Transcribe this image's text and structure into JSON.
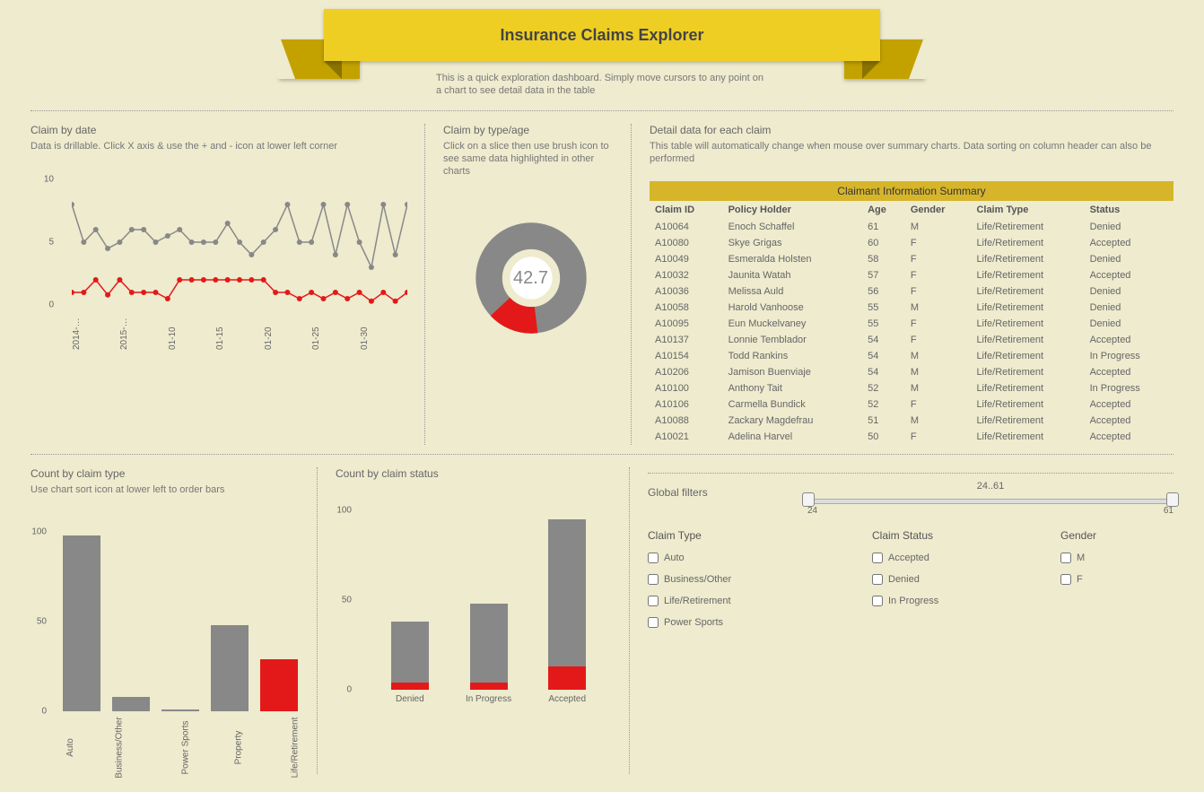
{
  "header": {
    "title": "Insurance Claims Explorer",
    "subtitle": "This is a quick exploration dashboard. Simply move cursors to any point on a chart to see detail data in the table"
  },
  "claim_by_date": {
    "title": "Claim by date",
    "hint": "Data is drillable. Click X axis & use the + and - icon at lower left corner"
  },
  "claim_by_type_age": {
    "title": "Claim by type/age",
    "hint": "Click on a slice then use brush icon to see same data highlighted in other charts",
    "center_value": "42.7"
  },
  "detail": {
    "title": "Detail data for each claim",
    "hint": "This table will automatically change when mouse over summary charts. Data sorting on column header can also be performed",
    "table_title": "Claimant Information Summary",
    "columns": [
      "Claim ID",
      "Policy Holder",
      "Age",
      "Gender",
      "Claim Type",
      "Status"
    ],
    "rows": [
      {
        "id": "A10064",
        "name": "Enoch Schaffel",
        "age": "61",
        "gender": "M",
        "type": "Life/Retirement",
        "status": "Denied"
      },
      {
        "id": "A10080",
        "name": "Skye Grigas",
        "age": "60",
        "gender": "F",
        "type": "Life/Retirement",
        "status": "Accepted"
      },
      {
        "id": "A10049",
        "name": "Esmeralda Holsten",
        "age": "58",
        "gender": "F",
        "type": "Life/Retirement",
        "status": "Denied"
      },
      {
        "id": "A10032",
        "name": "Jaunita Watah",
        "age": "57",
        "gender": "F",
        "type": "Life/Retirement",
        "status": "Accepted"
      },
      {
        "id": "A10036",
        "name": "Melissa Auld",
        "age": "56",
        "gender": "F",
        "type": "Life/Retirement",
        "status": "Denied"
      },
      {
        "id": "A10058",
        "name": "Harold Vanhoose",
        "age": "55",
        "gender": "M",
        "type": "Life/Retirement",
        "status": "Denied"
      },
      {
        "id": "A10095",
        "name": "Eun Muckelvaney",
        "age": "55",
        "gender": "F",
        "type": "Life/Retirement",
        "status": "Denied"
      },
      {
        "id": "A10137",
        "name": "Lonnie Temblador",
        "age": "54",
        "gender": "F",
        "type": "Life/Retirement",
        "status": "Accepted"
      },
      {
        "id": "A10154",
        "name": "Todd Rankins",
        "age": "54",
        "gender": "M",
        "type": "Life/Retirement",
        "status": "In Progress"
      },
      {
        "id": "A10206",
        "name": "Jamison Buenviaje",
        "age": "54",
        "gender": "M",
        "type": "Life/Retirement",
        "status": "Accepted"
      },
      {
        "id": "A10100",
        "name": "Anthony Tait",
        "age": "52",
        "gender": "M",
        "type": "Life/Retirement",
        "status": "In Progress"
      },
      {
        "id": "A10106",
        "name": "Carmella Bundick",
        "age": "52",
        "gender": "F",
        "type": "Life/Retirement",
        "status": "Accepted"
      },
      {
        "id": "A10088",
        "name": "Zackary Magdefrau",
        "age": "51",
        "gender": "M",
        "type": "Life/Retirement",
        "status": "Accepted"
      },
      {
        "id": "A10021",
        "name": "Adelina Harvel",
        "age": "50",
        "gender": "F",
        "type": "Life/Retirement",
        "status": "Accepted"
      }
    ]
  },
  "count_by_type": {
    "title": "Count by claim type",
    "hint": "Use chart sort icon at lower left to order bars"
  },
  "count_by_status": {
    "title": "Count by claim status"
  },
  "filters": {
    "label": "Global filters",
    "range_label": "24..61",
    "range_min": "24",
    "range_max": "61",
    "claim_type_title": "Claim Type",
    "claim_type_options": [
      "Auto",
      "Business/Other",
      "Life/Retirement",
      "Power Sports"
    ],
    "claim_status_title": "Claim Status",
    "claim_status_options": [
      "Accepted",
      "Denied",
      "In Progress"
    ],
    "gender_title": "Gender",
    "gender_options": [
      "M",
      "F"
    ]
  },
  "chart_data": [
    {
      "type": "line",
      "name": "claim_by_date",
      "x": [
        "2014-…",
        "2015-…",
        "01-10",
        "01-15",
        "01-20",
        "01-25",
        "01-30"
      ],
      "yticks": [
        0,
        5,
        10
      ],
      "ylim": [
        0,
        10
      ],
      "series": [
        {
          "name": "series1",
          "color": "#888",
          "values": [
            8,
            5,
            6,
            4.5,
            5,
            6,
            6,
            5,
            5.5,
            6,
            5,
            5,
            5,
            6.5,
            5,
            4,
            5,
            6,
            8,
            5,
            5,
            8,
            4,
            8,
            5,
            3,
            8,
            4,
            8
          ]
        },
        {
          "name": "series2",
          "color": "#e31919",
          "values": [
            1,
            1,
            2,
            0.8,
            2,
            1,
            1,
            1,
            0.5,
            2,
            2,
            2,
            2,
            2,
            2,
            2,
            2,
            1,
            1,
            0.5,
            1,
            0.5,
            1,
            0.5,
            1,
            0.3,
            1,
            0.3,
            1
          ]
        }
      ]
    },
    {
      "type": "pie",
      "name": "claim_by_type_age",
      "center_value": 42.7,
      "series": [
        {
          "name": "highlighted",
          "value": 15,
          "color": "#e31919"
        },
        {
          "name": "other",
          "value": 85,
          "color": "#888"
        }
      ]
    },
    {
      "type": "bar",
      "name": "count_by_claim_type",
      "categories": [
        "Auto",
        "Business/Other",
        "Power Sports",
        "Property",
        "Life/Retirement"
      ],
      "yticks": [
        0,
        50,
        100
      ],
      "ylim": [
        0,
        100
      ],
      "series": [
        {
          "name": "total",
          "color": "#888",
          "values": [
            98,
            8,
            1,
            48,
            29
          ]
        },
        {
          "name": "highlighted",
          "color": "#e31919",
          "values": [
            0,
            0,
            0,
            0,
            29
          ]
        }
      ]
    },
    {
      "type": "bar",
      "name": "count_by_claim_status",
      "categories": [
        "Denied",
        "In Progress",
        "Accepted"
      ],
      "yticks": [
        0,
        50,
        100
      ],
      "ylim": [
        0,
        100
      ],
      "series": [
        {
          "name": "total",
          "color": "#888",
          "values": [
            38,
            48,
            95
          ]
        },
        {
          "name": "highlighted",
          "color": "#e31919",
          "values": [
            4,
            4,
            13
          ]
        }
      ]
    }
  ]
}
